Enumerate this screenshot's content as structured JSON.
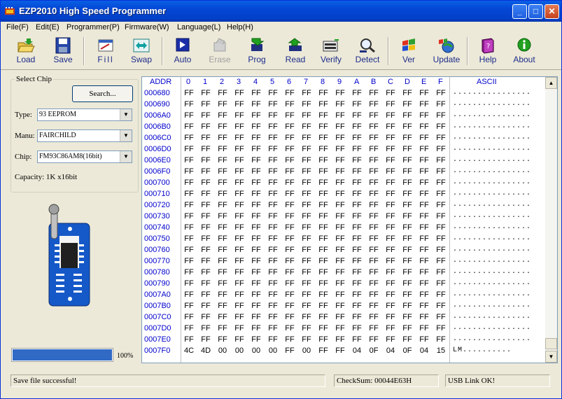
{
  "window": {
    "title": "EZP2010 High Speed Programmer",
    "minimize": "_",
    "maximize": "□",
    "close": "✕"
  },
  "menu": [
    "File(F)",
    "Edit(E)",
    "Programmer(P)",
    "Firmware(W)",
    "Language(L)",
    "Help(H)"
  ],
  "toolbar": {
    "load": "Load",
    "save": "Save",
    "fill": "Fill",
    "swap": "Swap",
    "auto": "Auto",
    "erase": "Erase",
    "prog": "Prog",
    "read": "Read",
    "verify": "Verify",
    "detect": "Detect",
    "ver": "Ver",
    "update": "Update",
    "help": "Help",
    "about": "About"
  },
  "chip": {
    "group_title": "Select Chip",
    "search_button": "Search...",
    "type_label": "Type:",
    "type_value": "93 EEPROM",
    "manu_label": "Manu:",
    "manu_value": "FAIRCHILD",
    "chip_label": "Chip:",
    "chip_value": "FM93C86AM8(16bit)",
    "capacity": "Capacity: 1K x16bit"
  },
  "progress": {
    "value": 1.0,
    "label": "100%"
  },
  "hex": {
    "header": {
      "addr": "ADDR",
      "cols": [
        "0",
        "1",
        "2",
        "3",
        "4",
        "5",
        "6",
        "7",
        "8",
        "9",
        "A",
        "B",
        "C",
        "D",
        "E",
        "F"
      ],
      "ascii": "ASCII"
    },
    "rows": [
      {
        "addr": "000680",
        "bytes": [
          "FF",
          "FF",
          "FF",
          "FF",
          "FF",
          "FF",
          "FF",
          "FF",
          "FF",
          "FF",
          "FF",
          "FF",
          "FF",
          "FF",
          "FF",
          "FF"
        ],
        "ascii": "................"
      },
      {
        "addr": "000690",
        "bytes": [
          "FF",
          "FF",
          "FF",
          "FF",
          "FF",
          "FF",
          "FF",
          "FF",
          "FF",
          "FF",
          "FF",
          "FF",
          "FF",
          "FF",
          "FF",
          "FF"
        ],
        "ascii": "................"
      },
      {
        "addr": "0006A0",
        "bytes": [
          "FF",
          "FF",
          "FF",
          "FF",
          "FF",
          "FF",
          "FF",
          "FF",
          "FF",
          "FF",
          "FF",
          "FF",
          "FF",
          "FF",
          "FF",
          "FF"
        ],
        "ascii": "................"
      },
      {
        "addr": "0006B0",
        "bytes": [
          "FF",
          "FF",
          "FF",
          "FF",
          "FF",
          "FF",
          "FF",
          "FF",
          "FF",
          "FF",
          "FF",
          "FF",
          "FF",
          "FF",
          "FF",
          "FF"
        ],
        "ascii": "................"
      },
      {
        "addr": "0006C0",
        "bytes": [
          "FF",
          "FF",
          "FF",
          "FF",
          "FF",
          "FF",
          "FF",
          "FF",
          "FF",
          "FF",
          "FF",
          "FF",
          "FF",
          "FF",
          "FF",
          "FF"
        ],
        "ascii": "................"
      },
      {
        "addr": "0006D0",
        "bytes": [
          "FF",
          "FF",
          "FF",
          "FF",
          "FF",
          "FF",
          "FF",
          "FF",
          "FF",
          "FF",
          "FF",
          "FF",
          "FF",
          "FF",
          "FF",
          "FF"
        ],
        "ascii": "................"
      },
      {
        "addr": "0006E0",
        "bytes": [
          "FF",
          "FF",
          "FF",
          "FF",
          "FF",
          "FF",
          "FF",
          "FF",
          "FF",
          "FF",
          "FF",
          "FF",
          "FF",
          "FF",
          "FF",
          "FF"
        ],
        "ascii": "................"
      },
      {
        "addr": "0006F0",
        "bytes": [
          "FF",
          "FF",
          "FF",
          "FF",
          "FF",
          "FF",
          "FF",
          "FF",
          "FF",
          "FF",
          "FF",
          "FF",
          "FF",
          "FF",
          "FF",
          "FF"
        ],
        "ascii": "................"
      },
      {
        "addr": "000700",
        "bytes": [
          "FF",
          "FF",
          "FF",
          "FF",
          "FF",
          "FF",
          "FF",
          "FF",
          "FF",
          "FF",
          "FF",
          "FF",
          "FF",
          "FF",
          "FF",
          "FF"
        ],
        "ascii": "................"
      },
      {
        "addr": "000710",
        "bytes": [
          "FF",
          "FF",
          "FF",
          "FF",
          "FF",
          "FF",
          "FF",
          "FF",
          "FF",
          "FF",
          "FF",
          "FF",
          "FF",
          "FF",
          "FF",
          "FF"
        ],
        "ascii": "................"
      },
      {
        "addr": "000720",
        "bytes": [
          "FF",
          "FF",
          "FF",
          "FF",
          "FF",
          "FF",
          "FF",
          "FF",
          "FF",
          "FF",
          "FF",
          "FF",
          "FF",
          "FF",
          "FF",
          "FF"
        ],
        "ascii": "................"
      },
      {
        "addr": "000730",
        "bytes": [
          "FF",
          "FF",
          "FF",
          "FF",
          "FF",
          "FF",
          "FF",
          "FF",
          "FF",
          "FF",
          "FF",
          "FF",
          "FF",
          "FF",
          "FF",
          "FF"
        ],
        "ascii": "................"
      },
      {
        "addr": "000740",
        "bytes": [
          "FF",
          "FF",
          "FF",
          "FF",
          "FF",
          "FF",
          "FF",
          "FF",
          "FF",
          "FF",
          "FF",
          "FF",
          "FF",
          "FF",
          "FF",
          "FF"
        ],
        "ascii": "................"
      },
      {
        "addr": "000750",
        "bytes": [
          "FF",
          "FF",
          "FF",
          "FF",
          "FF",
          "FF",
          "FF",
          "FF",
          "FF",
          "FF",
          "FF",
          "FF",
          "FF",
          "FF",
          "FF",
          "FF"
        ],
        "ascii": "................"
      },
      {
        "addr": "000760",
        "bytes": [
          "FF",
          "FF",
          "FF",
          "FF",
          "FF",
          "FF",
          "FF",
          "FF",
          "FF",
          "FF",
          "FF",
          "FF",
          "FF",
          "FF",
          "FF",
          "FF"
        ],
        "ascii": "................"
      },
      {
        "addr": "000770",
        "bytes": [
          "FF",
          "FF",
          "FF",
          "FF",
          "FF",
          "FF",
          "FF",
          "FF",
          "FF",
          "FF",
          "FF",
          "FF",
          "FF",
          "FF",
          "FF",
          "FF"
        ],
        "ascii": "................"
      },
      {
        "addr": "000780",
        "bytes": [
          "FF",
          "FF",
          "FF",
          "FF",
          "FF",
          "FF",
          "FF",
          "FF",
          "FF",
          "FF",
          "FF",
          "FF",
          "FF",
          "FF",
          "FF",
          "FF"
        ],
        "ascii": "................"
      },
      {
        "addr": "000790",
        "bytes": [
          "FF",
          "FF",
          "FF",
          "FF",
          "FF",
          "FF",
          "FF",
          "FF",
          "FF",
          "FF",
          "FF",
          "FF",
          "FF",
          "FF",
          "FF",
          "FF"
        ],
        "ascii": "................"
      },
      {
        "addr": "0007A0",
        "bytes": [
          "FF",
          "FF",
          "FF",
          "FF",
          "FF",
          "FF",
          "FF",
          "FF",
          "FF",
          "FF",
          "FF",
          "FF",
          "FF",
          "FF",
          "FF",
          "FF"
        ],
        "ascii": "................"
      },
      {
        "addr": "0007B0",
        "bytes": [
          "FF",
          "FF",
          "FF",
          "FF",
          "FF",
          "FF",
          "FF",
          "FF",
          "FF",
          "FF",
          "FF",
          "FF",
          "FF",
          "FF",
          "FF",
          "FF"
        ],
        "ascii": "................"
      },
      {
        "addr": "0007C0",
        "bytes": [
          "FF",
          "FF",
          "FF",
          "FF",
          "FF",
          "FF",
          "FF",
          "FF",
          "FF",
          "FF",
          "FF",
          "FF",
          "FF",
          "FF",
          "FF",
          "FF"
        ],
        "ascii": "................"
      },
      {
        "addr": "0007D0",
        "bytes": [
          "FF",
          "FF",
          "FF",
          "FF",
          "FF",
          "FF",
          "FF",
          "FF",
          "FF",
          "FF",
          "FF",
          "FF",
          "FF",
          "FF",
          "FF",
          "FF"
        ],
        "ascii": "................"
      },
      {
        "addr": "0007E0",
        "bytes": [
          "FF",
          "FF",
          "FF",
          "FF",
          "FF",
          "FF",
          "FF",
          "FF",
          "FF",
          "FF",
          "FF",
          "FF",
          "FF",
          "FF",
          "FF",
          "FF"
        ],
        "ascii": "................"
      },
      {
        "addr": "0007F0",
        "bytes": [
          "4C",
          "4D",
          "00",
          "00",
          "00",
          "00",
          "FF",
          "00",
          "FF",
          "FF",
          "04",
          "0F",
          "04",
          "0F",
          "04",
          "15"
        ],
        "ascii": "LM.........."
      }
    ]
  },
  "status": {
    "message": "Save file successful!",
    "checksum": "CheckSum: 00044E63H",
    "usb": "USB Link OK!"
  },
  "colors": {
    "title_bar": "#0446d4",
    "hex_addr": "#0000cc",
    "progress": "#316ac5",
    "toolbar_label": "#1c2b8a"
  }
}
